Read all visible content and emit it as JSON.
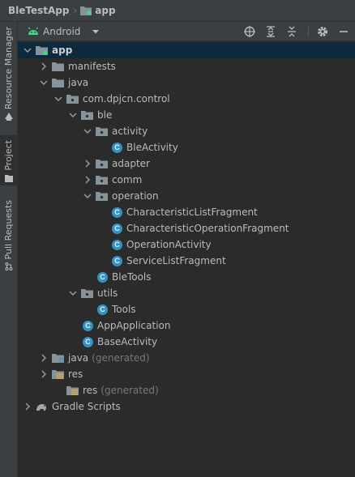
{
  "breadcrumb": {
    "project": "BleTestApp",
    "module": "app"
  },
  "sidebar": {
    "tabs": [
      {
        "label": "Resource Manager"
      },
      {
        "label": "Project"
      },
      {
        "label": "Pull Requests"
      }
    ]
  },
  "toolbar": {
    "view_mode": "Android"
  },
  "tree": [
    {
      "label": "app",
      "type": "module",
      "expanded": true
    },
    {
      "label": "manifests",
      "type": "folder",
      "expanded": false
    },
    {
      "label": "java",
      "type": "folder",
      "expanded": true
    },
    {
      "label": "com.dpjcn.control",
      "type": "package",
      "expanded": true
    },
    {
      "label": "ble",
      "type": "package",
      "expanded": true
    },
    {
      "label": "activity",
      "type": "package",
      "expanded": true
    },
    {
      "label": "BleActivity",
      "type": "class"
    },
    {
      "label": "adapter",
      "type": "package",
      "expanded": false
    },
    {
      "label": "comm",
      "type": "package",
      "expanded": false
    },
    {
      "label": "operation",
      "type": "package",
      "expanded": true
    },
    {
      "label": "CharacteristicListFragment",
      "type": "class"
    },
    {
      "label": "CharacteristicOperationFragment",
      "type": "class"
    },
    {
      "label": "OperationActivity",
      "type": "class"
    },
    {
      "label": "ServiceListFragment",
      "type": "class"
    },
    {
      "label": "BleTools",
      "type": "class"
    },
    {
      "label": "utils",
      "type": "package",
      "expanded": true
    },
    {
      "label": "Tools",
      "type": "class"
    },
    {
      "label": "AppApplication",
      "type": "class"
    },
    {
      "label": "BaseActivity",
      "type": "class"
    },
    {
      "label": "java",
      "suffix": "(generated)",
      "type": "gen-folder",
      "expanded": false
    },
    {
      "label": "res",
      "type": "res-folder",
      "expanded": false
    },
    {
      "label": "res",
      "suffix": "(generated)",
      "type": "res-folder"
    },
    {
      "label": "Gradle Scripts",
      "type": "gradle",
      "expanded": false
    }
  ],
  "colors": {
    "class_icon": "#3592c4",
    "folder": "#87939a",
    "android": "#3ddc84",
    "selected_row": "#0d293e"
  },
  "class_icon_letter": "C"
}
